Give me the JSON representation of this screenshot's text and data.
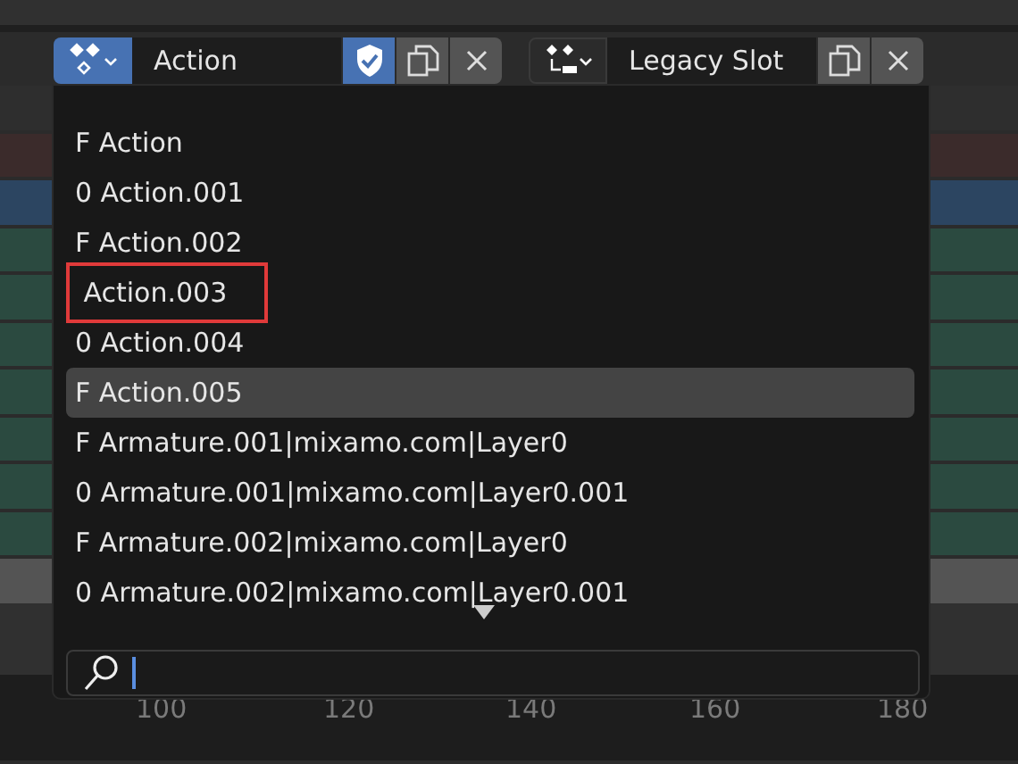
{
  "header": {
    "action_field": {
      "value": "Action",
      "fake_user": true
    },
    "slot_field": {
      "value": "Legacy Slot"
    }
  },
  "menu": {
    "items": [
      {
        "label": "F Action",
        "selected": false,
        "marked": false
      },
      {
        "label": "0 Action.001",
        "selected": false,
        "marked": false
      },
      {
        "label": "F Action.002",
        "selected": false,
        "marked": false
      },
      {
        "label": " Action.003",
        "selected": false,
        "marked": true
      },
      {
        "label": "0 Action.004",
        "selected": false,
        "marked": false
      },
      {
        "label": "F Action.005",
        "selected": true,
        "marked": false
      },
      {
        "label": "F Armature.001|mixamo.com|Layer0",
        "selected": false,
        "marked": false
      },
      {
        "label": "0 Armature.001|mixamo.com|Layer0.001",
        "selected": false,
        "marked": false
      },
      {
        "label": "F Armature.002|mixamo.com|Layer0",
        "selected": false,
        "marked": false
      },
      {
        "label": "0 Armature.002|mixamo.com|Layer0.001",
        "selected": false,
        "marked": false
      }
    ],
    "more_below": true
  },
  "ruler": {
    "labels": [
      "100",
      "120",
      "140",
      "160",
      "180"
    ]
  }
}
